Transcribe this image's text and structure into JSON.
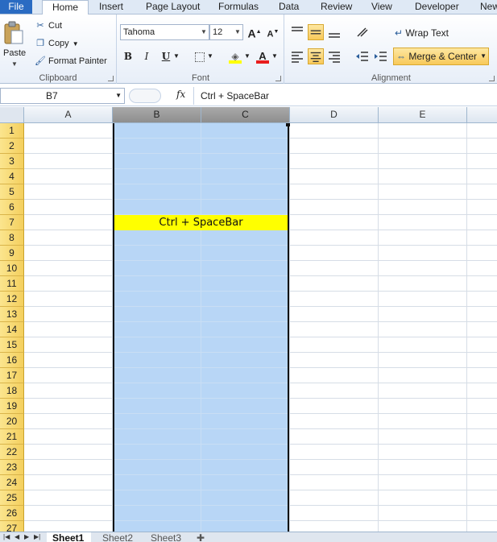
{
  "tabs": {
    "file": "File",
    "home": "Home",
    "insert": "Insert",
    "page_layout": "Page Layout",
    "formulas": "Formulas",
    "data": "Data",
    "review": "Review",
    "view": "View",
    "developer": "Developer",
    "new": "New"
  },
  "clipboard": {
    "paste": "Paste",
    "cut": "Cut",
    "copy": "Copy",
    "format_painter": "Format Painter",
    "label": "Clipboard"
  },
  "font": {
    "name": "Tahoma",
    "size": "12",
    "label": "Font",
    "bold": "B",
    "italic": "I",
    "underline": "U",
    "grow": "A",
    "shrink": "A",
    "font_color_letter": "A"
  },
  "alignment": {
    "wrap_text": "Wrap Text",
    "merge_center": "Merge & Center",
    "label": "Alignment"
  },
  "formula_bar": {
    "name_box": "B7",
    "fx": "fx",
    "content": "Ctrl + SpaceBar"
  },
  "grid": {
    "columns": [
      "A",
      "B",
      "C",
      "D",
      "E"
    ],
    "rows": [
      "1",
      "2",
      "3",
      "4",
      "5",
      "6",
      "7",
      "8",
      "9",
      "10",
      "11",
      "12",
      "13",
      "14",
      "15",
      "16",
      "17",
      "18",
      "19",
      "20",
      "21",
      "22",
      "23",
      "24",
      "25",
      "26",
      "27"
    ],
    "selected_columns": [
      "B",
      "C"
    ],
    "active_cell": "B7",
    "active_cell_text": "Ctrl + SpaceBar"
  },
  "sheets": [
    "Sheet1",
    "Sheet2",
    "Sheet3"
  ],
  "colors": {
    "selection": "#b8d6f6",
    "active_fill": "#ffff00",
    "file_tab": "#2a6bc2"
  }
}
